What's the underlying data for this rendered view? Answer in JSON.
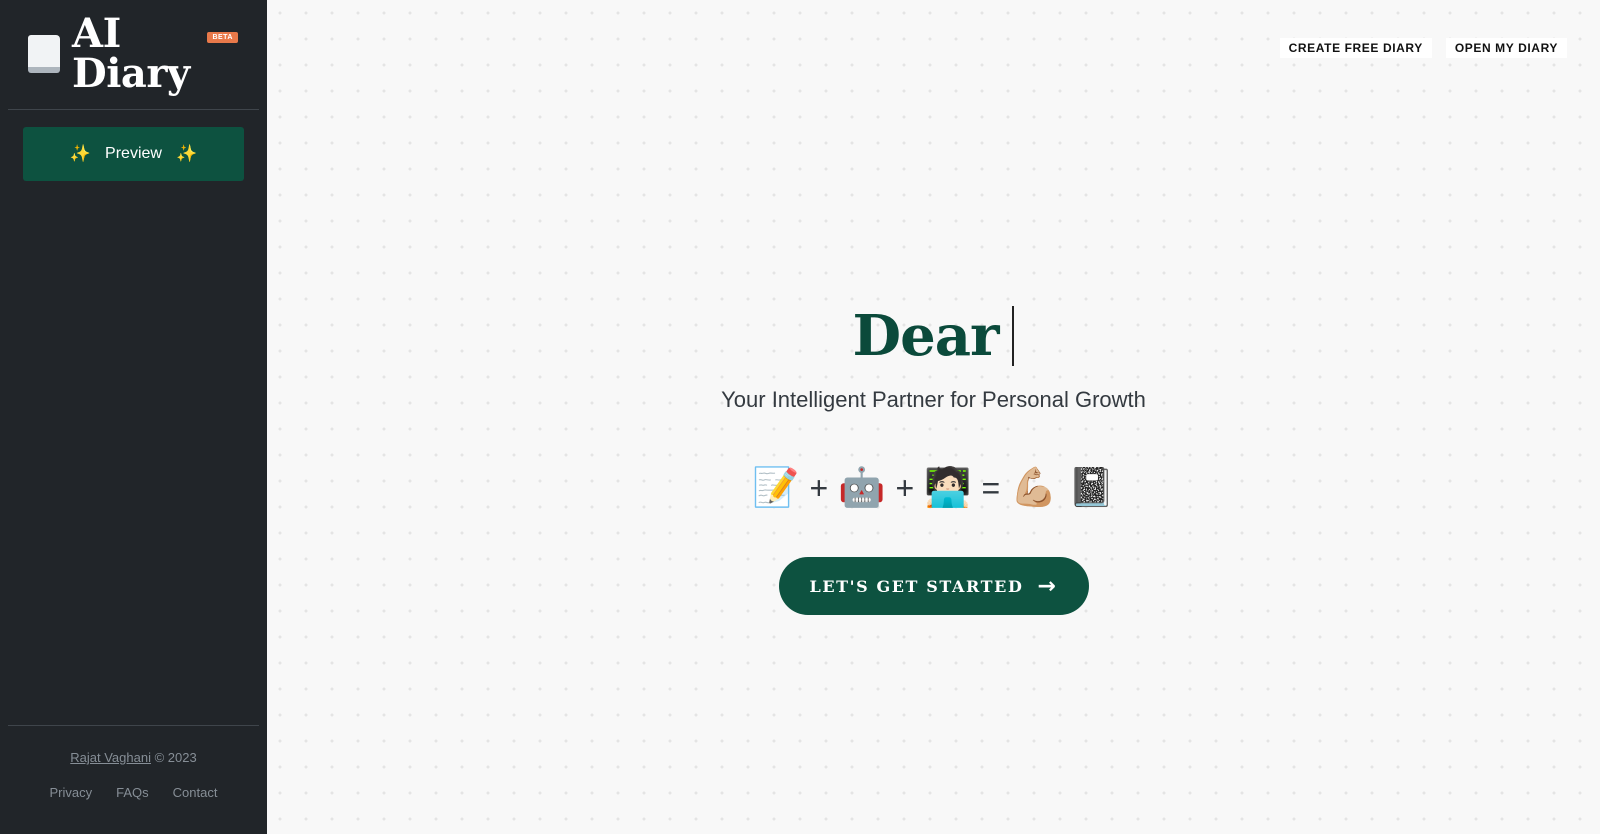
{
  "sidebar": {
    "logo_text": "AI Diary",
    "beta_label": "BETA",
    "preview_button": {
      "label": "Preview",
      "sparkle_left": "✨",
      "sparkle_right": "✨"
    },
    "footer": {
      "author": "Rajat Vaghani",
      "copyright": "© 2023",
      "links": [
        "Privacy",
        "FAQs",
        "Contact"
      ]
    }
  },
  "topnav": {
    "create_label": "CREATE FREE DIARY",
    "open_label": "OPEN MY DIARY"
  },
  "hero": {
    "title": "Dear",
    "subtitle": "Your Intelligent Partner for Personal Growth",
    "equation": {
      "memo": "📝",
      "plus1": "+",
      "robot": "🤖",
      "plus2": "+",
      "person": "🧑🏻‍💻",
      "equals": "=",
      "muscle": "💪🏼",
      "notebook": "📓"
    },
    "cta_label": "LET'S GET STARTED",
    "cta_arrow": "→"
  },
  "colors": {
    "sidebar_bg": "#212529",
    "brand_green": "#0d5240",
    "title_green": "#0b4a3b",
    "beta_orange": "#e8794a"
  },
  "icons": [
    "book-icon",
    "sparkle-icon",
    "arrow-right-icon"
  ]
}
